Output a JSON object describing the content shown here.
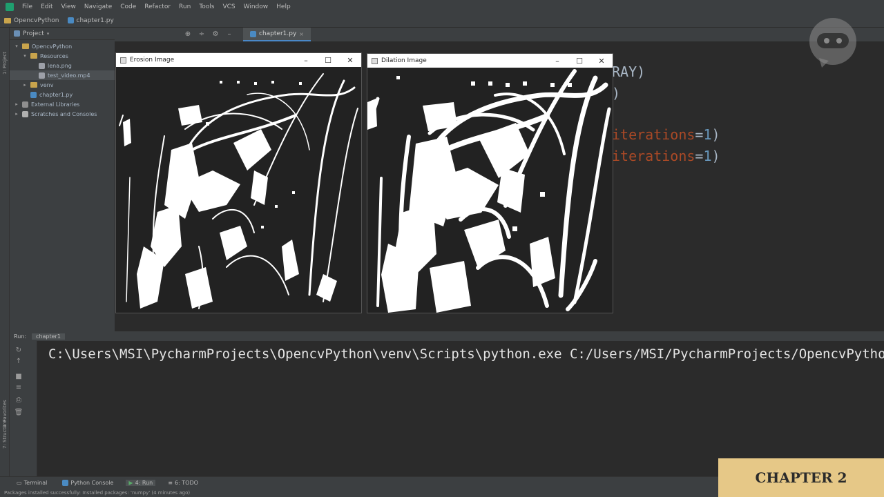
{
  "menu": [
    "File",
    "Edit",
    "View",
    "Navigate",
    "Code",
    "Refactor",
    "Run",
    "Tools",
    "VCS",
    "Window",
    "Help"
  ],
  "nav": {
    "project": "OpencvPython",
    "file": "chapter1.py"
  },
  "project_panel": {
    "title": "Project",
    "tree": [
      {
        "label": "OpencvPython",
        "level": 0,
        "kind": "folder",
        "open": true
      },
      {
        "label": "Resources",
        "level": 1,
        "kind": "folder",
        "open": true
      },
      {
        "label": "lena.png",
        "level": 2,
        "kind": "file"
      },
      {
        "label": "test_video.mp4",
        "level": 2,
        "kind": "file",
        "selected": true
      },
      {
        "label": "venv",
        "level": 1,
        "kind": "folder"
      },
      {
        "label": "chapter1.py",
        "level": 1,
        "kind": "py"
      },
      {
        "label": "External Libraries",
        "level": 0,
        "kind": "lib"
      },
      {
        "label": "Scratches and Consoles",
        "level": 0,
        "kind": "scratch"
      }
    ]
  },
  "left_strip": {
    "project_label": "1: Project",
    "structure_label": "7: Structure",
    "favorites_label": "2: Favorites"
  },
  "editor": {
    "tab": "chapter1.py",
    "code_fragments": {
      "l1": "RAY)",
      "l2": ")",
      "l3_a": "iterations",
      "l3_b": "=",
      "l3_c": "1",
      "l3_d": ")",
      "l4_a": "iterations",
      "l4_b": "=",
      "l4_c": "1",
      "l4_d": ")"
    }
  },
  "windows": {
    "erosion": {
      "title": "Erosion Image"
    },
    "dilation": {
      "title": "Dilation Image"
    }
  },
  "run_panel": {
    "run_label": "Run:",
    "config": "chapter1",
    "console_line": "C:\\Users\\MSI\\PycharmProjects\\OpencvPython\\venv\\Scripts\\python.exe C:/Users/MSI/PycharmProjects/OpencvPython/c"
  },
  "bottom_bar": [
    "Terminal",
    "Python Console",
    "4: Run",
    "6: TODO"
  ],
  "status": "Packages installed successfully: Installed packages: 'numpy' (4 minutes ago)",
  "badge": "CHAPTER 2",
  "colors": {
    "accent": "#4a88c7",
    "badge_bg": "#e6c887",
    "editor_bg": "#2b2b2b",
    "panel_bg": "#3c3f41"
  }
}
